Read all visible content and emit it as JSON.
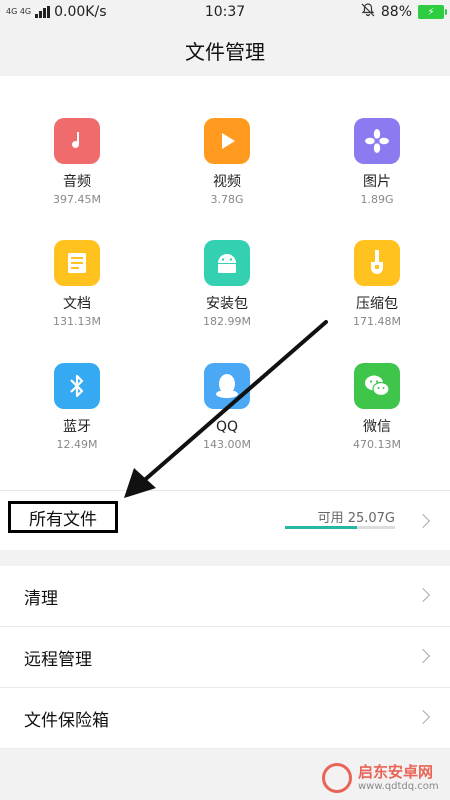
{
  "status_bar": {
    "network_type": "4G 4G",
    "speed": "0.00K/s",
    "time": "10:37",
    "battery_percent": "88%",
    "battery_level": 0.88,
    "battery_color": "#2ecc40"
  },
  "header": {
    "title": "文件管理"
  },
  "categories": [
    {
      "name": "音频",
      "size": "397.45M",
      "icon": "music-note-icon",
      "color": "#f06b6b"
    },
    {
      "name": "视频",
      "size": "3.78G",
      "icon": "play-icon",
      "color": "#ff9a1f"
    },
    {
      "name": "图片",
      "size": "1.89G",
      "icon": "flower-icon",
      "color": "#8a7bf0"
    },
    {
      "name": "文档",
      "size": "131.13M",
      "icon": "document-icon",
      "color": "#ffc21f"
    },
    {
      "name": "安装包",
      "size": "182.99M",
      "icon": "android-icon",
      "color": "#33d1b1"
    },
    {
      "name": "压缩包",
      "size": "171.48M",
      "icon": "zip-icon",
      "color": "#ffc21f"
    },
    {
      "name": "蓝牙",
      "size": "12.49M",
      "icon": "bluetooth-icon",
      "color": "#35a9f2"
    },
    {
      "name": "QQ",
      "size": "143.00M",
      "icon": "qq-penguin-icon",
      "color": "#4aa8f5"
    },
    {
      "name": "微信",
      "size": "470.13M",
      "icon": "wechat-icon",
      "color": "#3ec54a"
    }
  ],
  "all_files": {
    "label": "所有文件",
    "available_text": "可用 25.07G",
    "storage_available_fraction": 0.65,
    "bar_color": "#26b6a3"
  },
  "menu": [
    {
      "label": "清理"
    },
    {
      "label": "远程管理"
    },
    {
      "label": "文件保险箱"
    }
  ],
  "watermark": {
    "line1": "启东安卓网",
    "line2": "www.qdtdq.com"
  }
}
